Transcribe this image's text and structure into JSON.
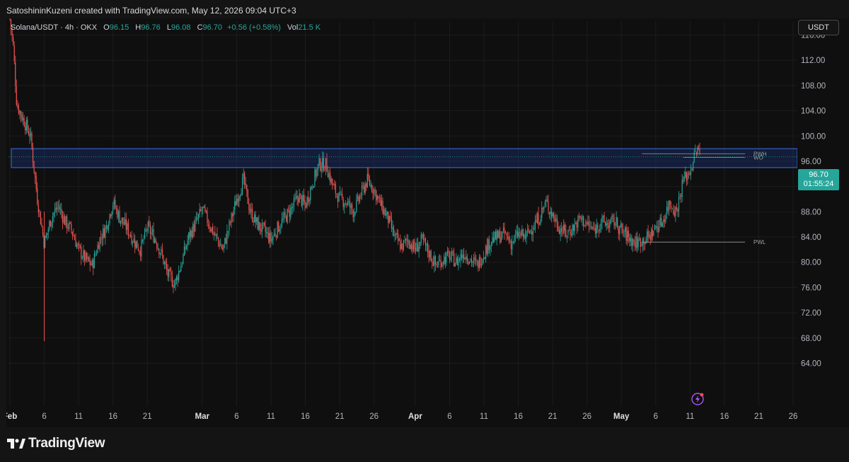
{
  "attribution": "SatoshininKuzeni created with TradingView.com, May 12, 2026 09:04 UTC+3",
  "legend": {
    "symbol": "Solana/USDT · 4h · OKX",
    "open_label": "O",
    "open": "96.15",
    "high_label": "H",
    "high": "96.76",
    "low_label": "L",
    "low": "96.08",
    "close_label": "C",
    "close": "96.70",
    "change": "+0.56 (+0.58%)",
    "vol_label": "Vol",
    "vol": "21.5 K"
  },
  "currency_button": "USDT",
  "last_price": {
    "value": "96.70",
    "countdown": "01:55:24"
  },
  "colors": {
    "up": "#26a69a",
    "down": "#ef5350",
    "zone_fill": "#1e3a8a",
    "zone_border": "#3b6fe0",
    "background": "#0f0f0f"
  },
  "icons": {
    "brand": "tradingview-logo-icon",
    "lightning": "lightning-icon"
  },
  "brand_name": "TradingView",
  "chart_data": {
    "type": "candlestick",
    "title": "Solana/USDT · 4h · OKX",
    "ylim": [
      60,
      120
    ],
    "y_ticks": [
      "116.00",
      "112.00",
      "108.00",
      "104.00",
      "100.00",
      "96.00",
      "92.00",
      "88.00",
      "84.00",
      "80.00",
      "76.00",
      "72.00",
      "68.00",
      "64.00"
    ],
    "x_ticks": [
      "Feb",
      "6",
      "11",
      "16",
      "21",
      "Mar",
      "6",
      "11",
      "16",
      "21",
      "26",
      "Apr",
      "6",
      "11",
      "16",
      "21",
      "26",
      "May",
      "6",
      "11",
      "16",
      "21",
      "26"
    ],
    "x_tick_dates": [
      "2026-02-01",
      "2026-02-06",
      "2026-02-11",
      "2026-02-16",
      "2026-02-21",
      "2026-03-01",
      "2026-03-06",
      "2026-03-11",
      "2026-03-16",
      "2026-03-21",
      "2026-03-26",
      "2026-04-01",
      "2026-04-06",
      "2026-04-11",
      "2026-04-16",
      "2026-04-21",
      "2026-04-26",
      "2026-05-01",
      "2026-05-06",
      "2026-05-11",
      "2026-05-16",
      "2026-05-21",
      "2026-05-26"
    ],
    "x_range": [
      "2026-02-01",
      "2026-05-28"
    ],
    "price_path": [
      [
        "2026-02-01",
        118.5
      ],
      [
        "2026-02-01",
        114.0
      ],
      [
        "2026-02-02",
        105.0
      ],
      [
        "2026-02-03",
        102.5
      ],
      [
        "2026-02-04",
        100.0
      ],
      [
        "2026-02-04",
        95.0
      ],
      [
        "2026-02-05",
        90.0
      ],
      [
        "2026-02-06",
        83.0
      ],
      [
        "2026-02-07",
        87.0
      ],
      [
        "2026-02-08",
        89.0
      ],
      [
        "2026-02-09",
        86.5
      ],
      [
        "2026-02-10",
        85.0
      ],
      [
        "2026-02-11",
        82.0
      ],
      [
        "2026-02-12",
        80.5
      ],
      [
        "2026-02-13",
        79.5
      ],
      [
        "2026-02-14",
        83.5
      ],
      [
        "2026-02-15",
        85.5
      ],
      [
        "2026-02-16",
        89.5
      ],
      [
        "2026-02-17",
        87.0
      ],
      [
        "2026-02-18",
        85.5
      ],
      [
        "2026-02-19",
        83.5
      ],
      [
        "2026-02-20",
        82.0
      ],
      [
        "2026-02-21",
        85.5
      ],
      [
        "2026-02-22",
        84.0
      ],
      [
        "2026-02-23",
        81.5
      ],
      [
        "2026-02-24",
        78.0
      ],
      [
        "2026-02-25",
        76.5
      ],
      [
        "2026-02-26",
        80.0
      ],
      [
        "2026-02-27",
        84.0
      ],
      [
        "2026-02-28",
        86.0
      ],
      [
        "2026-03-01",
        88.5
      ],
      [
        "2026-03-02",
        86.0
      ],
      [
        "2026-03-03",
        84.0
      ],
      [
        "2026-03-04",
        82.0
      ],
      [
        "2026-03-05",
        86.0
      ],
      [
        "2026-03-06",
        90.0
      ],
      [
        "2026-03-07",
        93.0
      ],
      [
        "2026-03-08",
        88.0
      ],
      [
        "2026-03-09",
        86.0
      ],
      [
        "2026-03-10",
        85.0
      ],
      [
        "2026-03-11",
        83.5
      ],
      [
        "2026-03-12",
        85.5
      ],
      [
        "2026-03-13",
        87.0
      ],
      [
        "2026-03-14",
        88.5
      ],
      [
        "2026-03-15",
        90.5
      ],
      [
        "2026-03-16",
        89.0
      ],
      [
        "2026-03-17",
        92.5
      ],
      [
        "2026-03-18",
        95.5
      ],
      [
        "2026-03-19",
        95.5
      ],
      [
        "2026-03-20",
        92.0
      ],
      [
        "2026-03-21",
        90.0
      ],
      [
        "2026-03-22",
        89.5
      ],
      [
        "2026-03-23",
        88.0
      ],
      [
        "2026-03-24",
        90.5
      ],
      [
        "2026-03-25",
        93.0
      ],
      [
        "2026-03-26",
        91.5
      ],
      [
        "2026-03-27",
        89.0
      ],
      [
        "2026-03-28",
        87.0
      ],
      [
        "2026-03-29",
        84.0
      ],
      [
        "2026-03-30",
        82.5
      ],
      [
        "2026-03-31",
        83.5
      ],
      [
        "2026-04-01",
        82.0
      ],
      [
        "2026-04-02",
        83.5
      ],
      [
        "2026-04-03",
        81.5
      ],
      [
        "2026-04-04",
        79.5
      ],
      [
        "2026-04-05",
        80.5
      ],
      [
        "2026-04-06",
        81.0
      ],
      [
        "2026-04-07",
        80.0
      ],
      [
        "2026-04-08",
        81.5
      ],
      [
        "2026-04-09",
        80.5
      ],
      [
        "2026-04-10",
        79.5
      ],
      [
        "2026-04-11",
        81.5
      ],
      [
        "2026-04-12",
        83.5
      ],
      [
        "2026-04-13",
        84.0
      ],
      [
        "2026-04-14",
        84.5
      ],
      [
        "2026-04-15",
        83.0
      ],
      [
        "2026-04-16",
        84.5
      ],
      [
        "2026-04-17",
        84.0
      ],
      [
        "2026-04-18",
        85.5
      ],
      [
        "2026-04-19",
        87.0
      ],
      [
        "2026-04-20",
        89.5
      ],
      [
        "2026-04-21",
        87.5
      ],
      [
        "2026-04-22",
        85.5
      ],
      [
        "2026-04-23",
        84.5
      ],
      [
        "2026-04-24",
        85.5
      ],
      [
        "2026-04-25",
        87.0
      ],
      [
        "2026-04-26",
        86.0
      ],
      [
        "2026-04-27",
        85.0
      ],
      [
        "2026-04-28",
        86.5
      ],
      [
        "2026-04-29",
        86.0
      ],
      [
        "2026-04-30",
        86.5
      ],
      [
        "2026-05-01",
        85.0
      ],
      [
        "2026-05-02",
        84.0
      ],
      [
        "2026-05-03",
        83.0
      ],
      [
        "2026-05-04",
        83.5
      ],
      [
        "2026-05-05",
        84.0
      ],
      [
        "2026-05-06",
        85.5
      ],
      [
        "2026-05-07",
        86.5
      ],
      [
        "2026-05-08",
        89.5
      ],
      [
        "2026-05-09",
        88.0
      ],
      [
        "2026-05-10",
        93.0
      ],
      [
        "2026-05-11",
        94.5
      ],
      [
        "2026-05-12",
        98.0
      ],
      [
        "2026-05-12",
        96.7
      ]
    ],
    "annotations": [
      {
        "type": "zone",
        "label": "",
        "from": "2026-02-01",
        "to": "2026-05-28",
        "low": 95.0,
        "high": 98.0
      },
      {
        "type": "level",
        "label": "PWH",
        "from": "2026-05-04",
        "to": "2026-05-19",
        "value": 97.2
      },
      {
        "type": "level",
        "label": "WO",
        "from": "2026-05-10",
        "to": "2026-05-19",
        "value": 96.6
      },
      {
        "type": "level",
        "label": "PWL",
        "from": "2026-05-04",
        "to": "2026-05-19",
        "value": 83.2
      },
      {
        "type": "last-price-line",
        "label": "",
        "value": 96.7
      }
    ]
  }
}
